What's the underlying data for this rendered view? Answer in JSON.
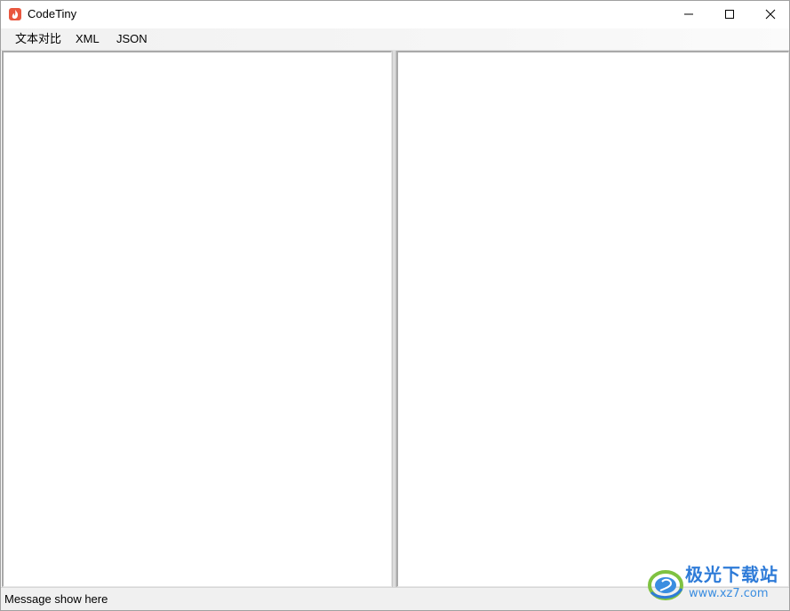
{
  "window": {
    "title": "CodeTiny",
    "icon": "flame-app-icon",
    "controls": {
      "minimize_icon": "minimize-icon",
      "maximize_icon": "maximize-icon",
      "close_icon": "close-icon"
    }
  },
  "menu": {
    "items": [
      {
        "label": "文本对比"
      },
      {
        "label": "XML"
      },
      {
        "label": "JSON"
      }
    ]
  },
  "editors": {
    "left_value": "",
    "right_value": ""
  },
  "status": {
    "message": "Message show here"
  },
  "watermark": {
    "brand": "极光下载站",
    "url": "www.xz7.com"
  },
  "colors": {
    "app_icon": "#e9573f",
    "watermark_blue": "#2e7bd8"
  }
}
